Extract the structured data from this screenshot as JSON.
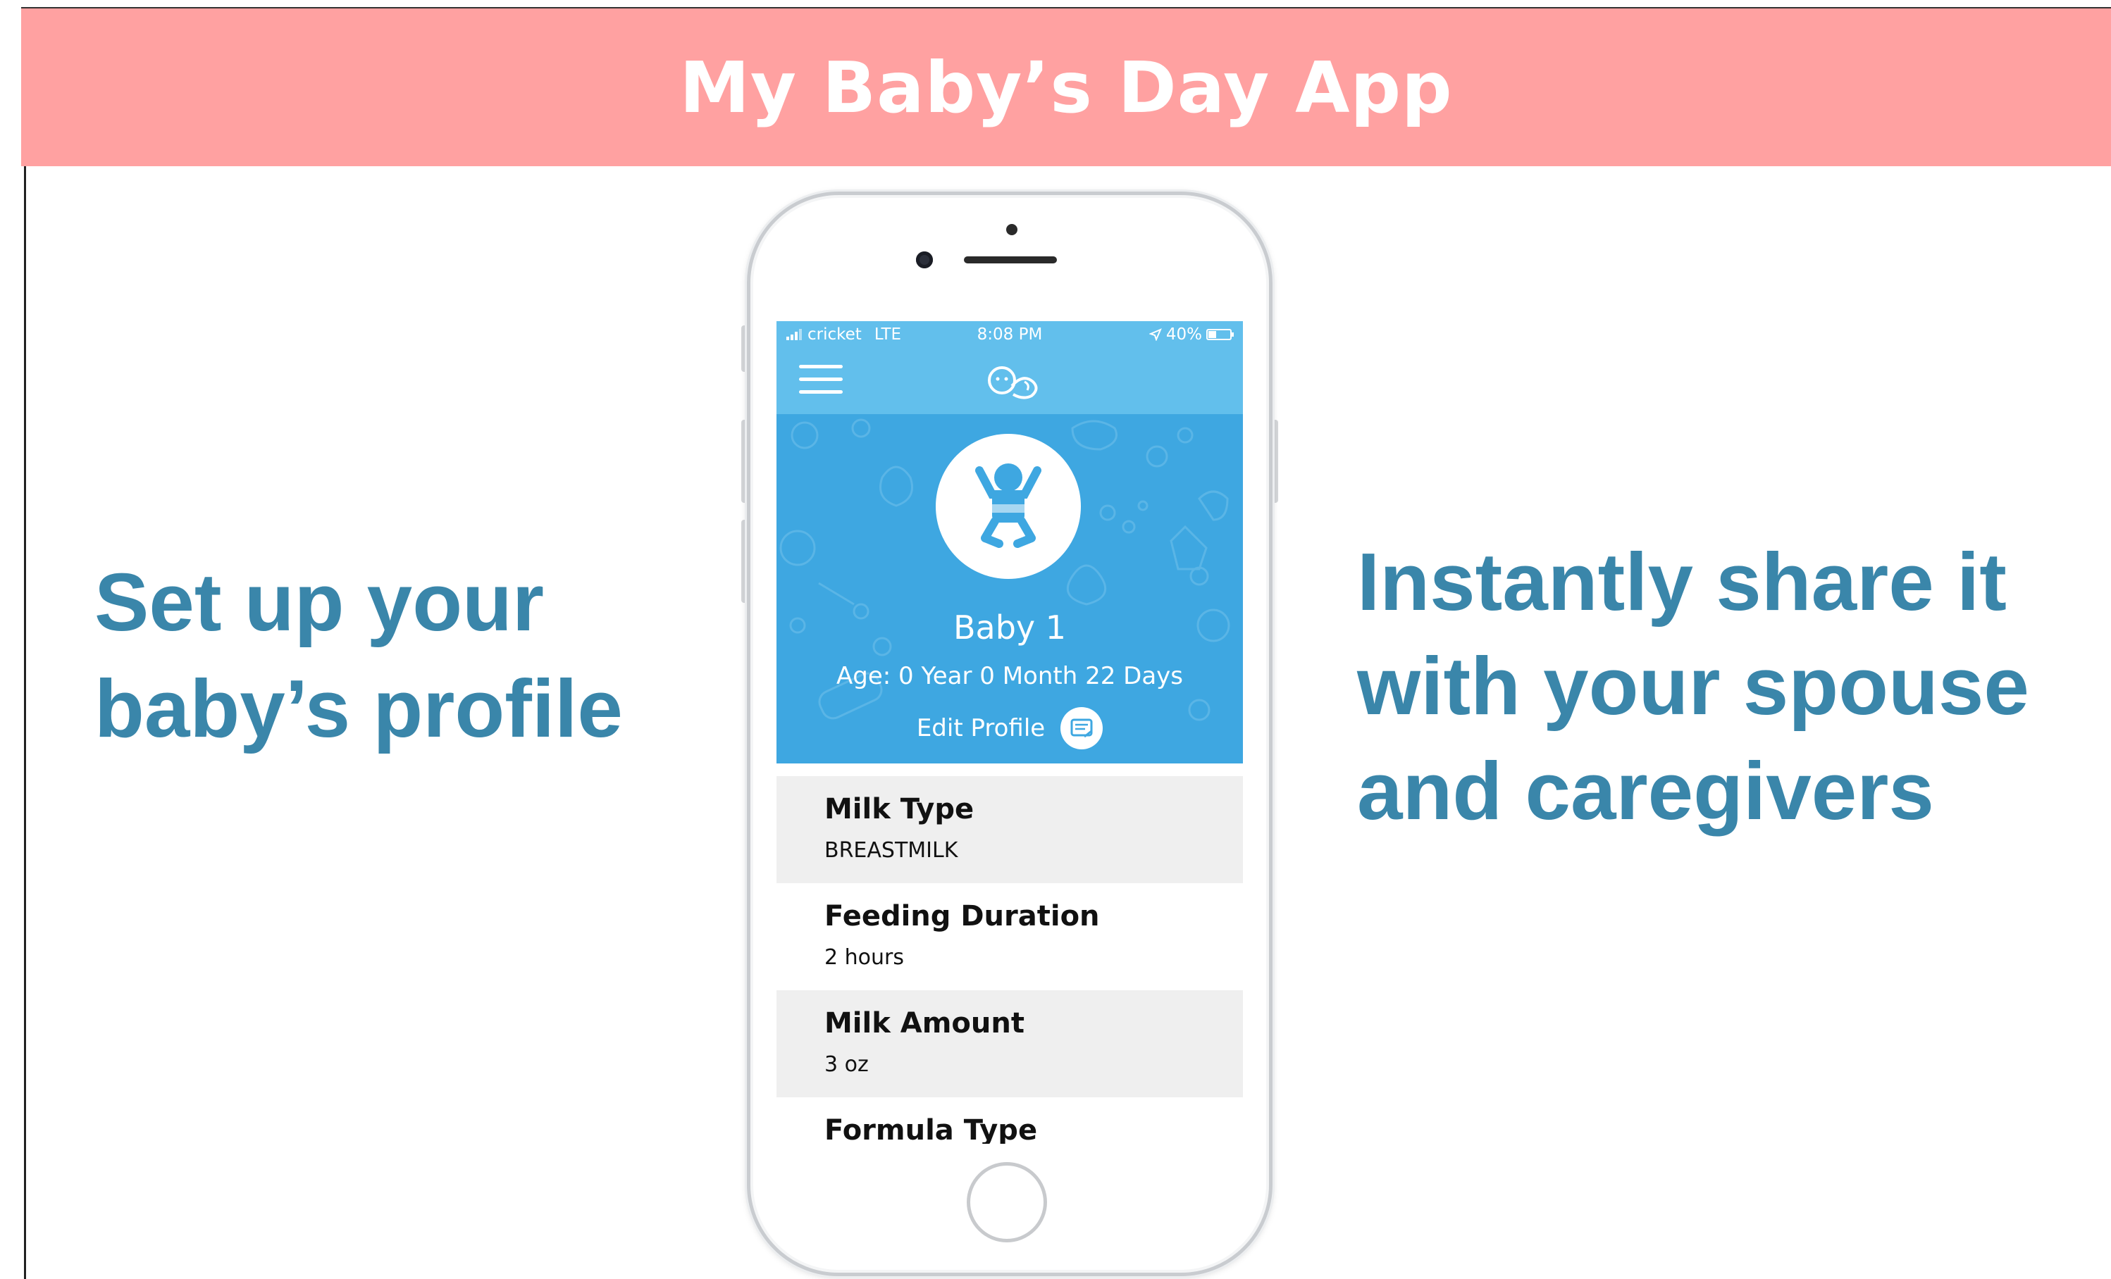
{
  "banner": {
    "title": "My Baby’s Day App"
  },
  "promo_left": {
    "line1": "Set up your",
    "line2": "baby’s profile"
  },
  "promo_right": {
    "line1": "Instantly share it",
    "line2": "with your spouse",
    "line3": "and caregivers"
  },
  "status_bar": {
    "carrier": "cricket",
    "network": "LTE",
    "time": "8:08 PM",
    "battery": "40%"
  },
  "nav": {
    "menu_icon": "hamburger-menu-icon",
    "logo_icon": "baby-face-logo-icon"
  },
  "profile": {
    "avatar_icon": "baby-icon",
    "name": "Baby 1",
    "age": "Age: 0 Year 0 Month 22 Days",
    "edit_label": "Edit Profile",
    "edit_icon": "edit-note-icon"
  },
  "details": [
    {
      "title": "Milk Type",
      "value": "BREASTMILK"
    },
    {
      "title": "Feeding Duration",
      "value": "2 hours"
    },
    {
      "title": "Milk Amount",
      "value": "3 oz"
    },
    {
      "title": "Formula Type",
      "value": ""
    }
  ],
  "colors": {
    "banner": "#ffa1a1",
    "promo_text": "#3a86aa",
    "nav_blue": "#62bfec",
    "hero_blue": "#3ea7e1",
    "row_alt": "#efefef"
  }
}
